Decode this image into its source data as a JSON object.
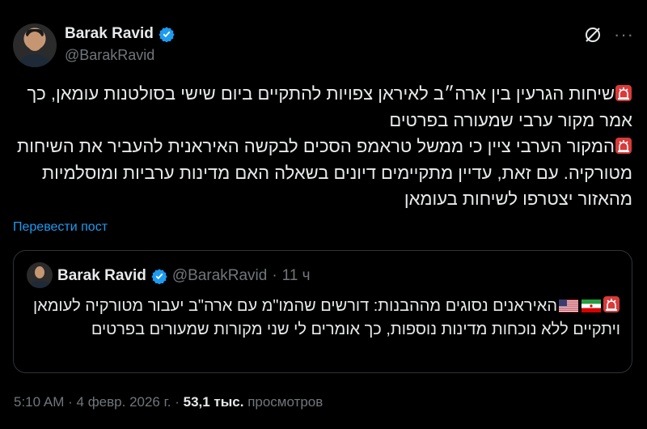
{
  "author": {
    "name": "Barak Ravid",
    "handle": "@BarakRavid"
  },
  "tweet": {
    "line1": "שיחות הגרעין בין ארה״ב לאיראן צפויות להתקיים ביום שישי בסולטנות עומאן, כך אמר מקור ערבי שמעורה בפרטים",
    "line2": "המקור הערבי ציין כי ממשל טראמפ הסכים לבקשה האיראנית להעביר את השיחות מטורקיה. עם זאת, עדיין מתקיימים דיונים בשאלה האם מדינות ערביות ומוסלמיות מהאזור יצטרפו לשיחות בעומאן"
  },
  "translate_label": "Перевести пост",
  "quote": {
    "name": "Barak Ravid",
    "handle": "@BarakRavid",
    "separator": "·",
    "time": "11 ч",
    "text": "האיראנים נסוגים מההבנות: דורשים שהמו\"מ עם ארה\"ב יעבור מטורקיה לעומאן ויתקיים ללא נוכחות מדינות נוספות, כך אומרים לי שני מקורות שמעורים בפרטים"
  },
  "meta": {
    "time": "5:10 AM",
    "sep1": "·",
    "date": "4 февр. 2026 г.",
    "sep2": "·",
    "views_count": "53,1 тыс.",
    "views_label": "просмотров"
  },
  "colors": {
    "background": "#000000",
    "text": "#e7e9ea",
    "secondary": "#71767b",
    "link": "#1d9bf0",
    "border": "#2f3336"
  },
  "icons": [
    "verified-badge-icon",
    "grok-icon",
    "more-icon",
    "siren-emoji-icon",
    "iran-flag-icon",
    "us-flag-icon"
  ]
}
